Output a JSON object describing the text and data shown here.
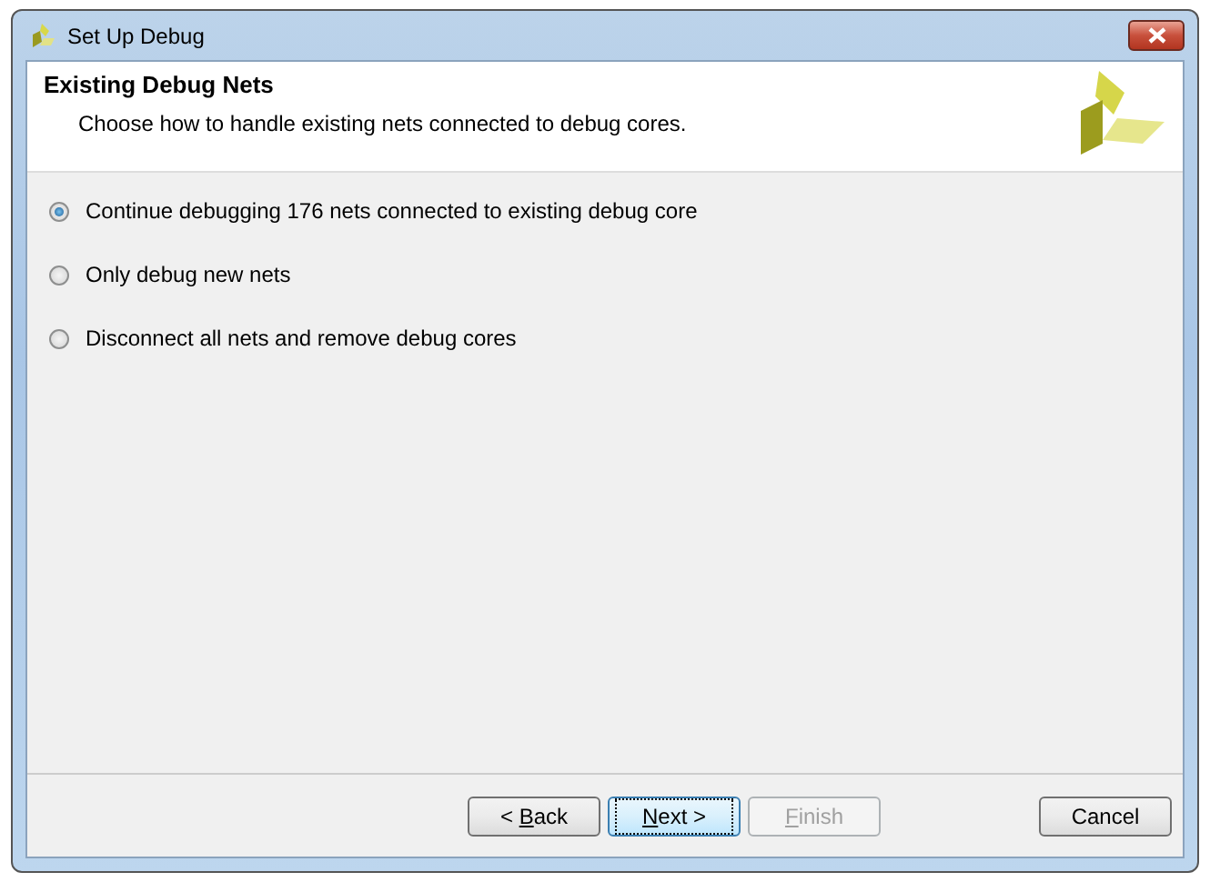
{
  "window": {
    "title": "Set Up Debug"
  },
  "header": {
    "title": "Existing Debug Nets",
    "subtitle": "Choose how to handle existing nets connected to debug cores."
  },
  "options": [
    {
      "label": "Continue debugging 176 nets connected to existing debug core",
      "selected": true
    },
    {
      "label": "Only debug new nets",
      "selected": false
    },
    {
      "label": "Disconnect all nets and remove debug cores",
      "selected": false
    }
  ],
  "buttons": [
    {
      "before": "< ",
      "key": "B",
      "after": "ack",
      "disabled": false,
      "focused": false
    },
    {
      "key": "N",
      "after": "ext >",
      "disabled": false,
      "focused": true
    },
    {
      "key": "F",
      "after": "inish",
      "disabled": true,
      "focused": false
    },
    {
      "before": "Cancel",
      "disabled": false,
      "focused": false
    }
  ]
}
